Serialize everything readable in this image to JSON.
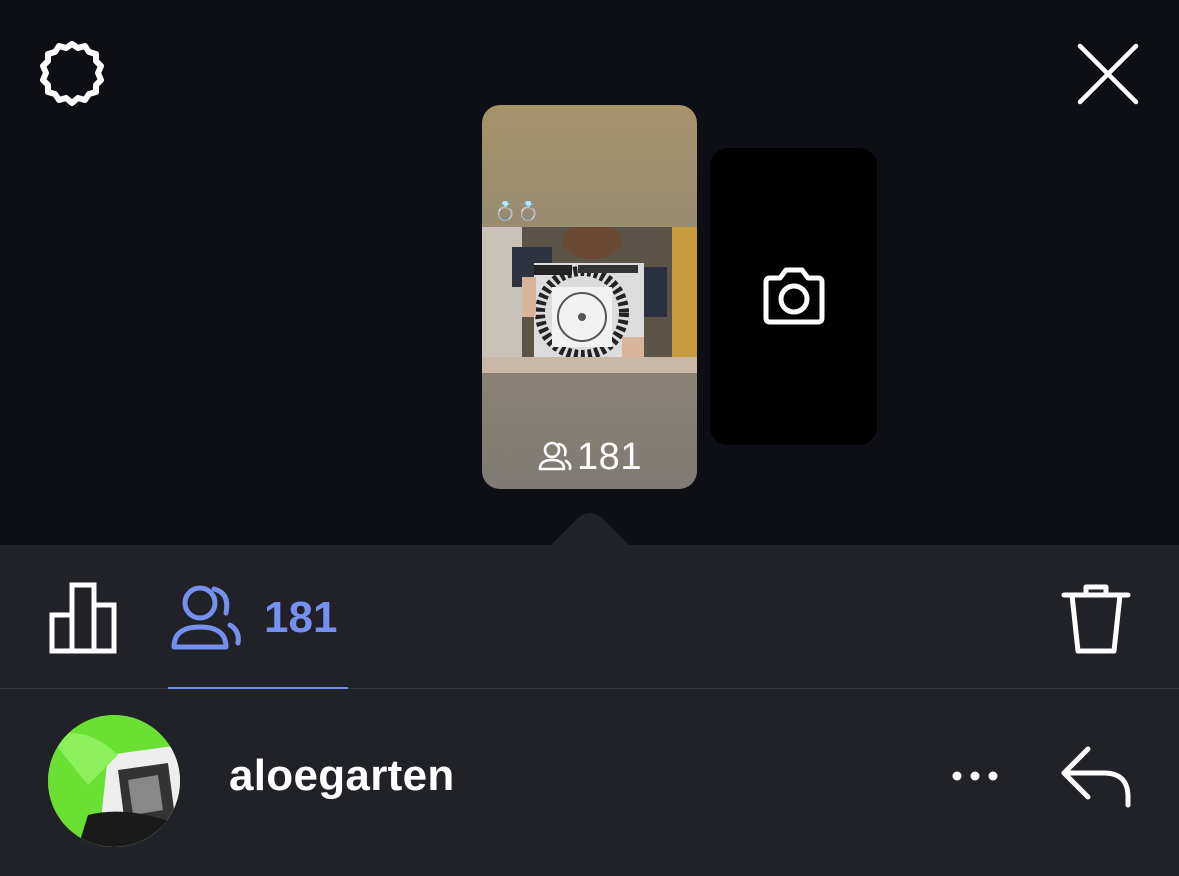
{
  "header": {
    "settings_icon": "gear-icon",
    "close_icon": "close-icon"
  },
  "story": {
    "emoji_overlay": "💍💍",
    "viewer_count": "181",
    "viewers_icon": "viewers-icon"
  },
  "camera": {
    "icon": "camera-icon"
  },
  "stats_bar": {
    "insights_icon": "bar-chart-icon",
    "viewers_icon": "viewers-icon",
    "viewer_count": "181",
    "delete_icon": "trash-icon",
    "accent_color": "#7690f0"
  },
  "viewer_row": {
    "username": "aloegarten",
    "more_icon": "more-icon",
    "reply_icon": "reply-icon"
  },
  "colors": {
    "background": "#0d0f14",
    "panel": "#202228",
    "accent": "#7690f0"
  }
}
